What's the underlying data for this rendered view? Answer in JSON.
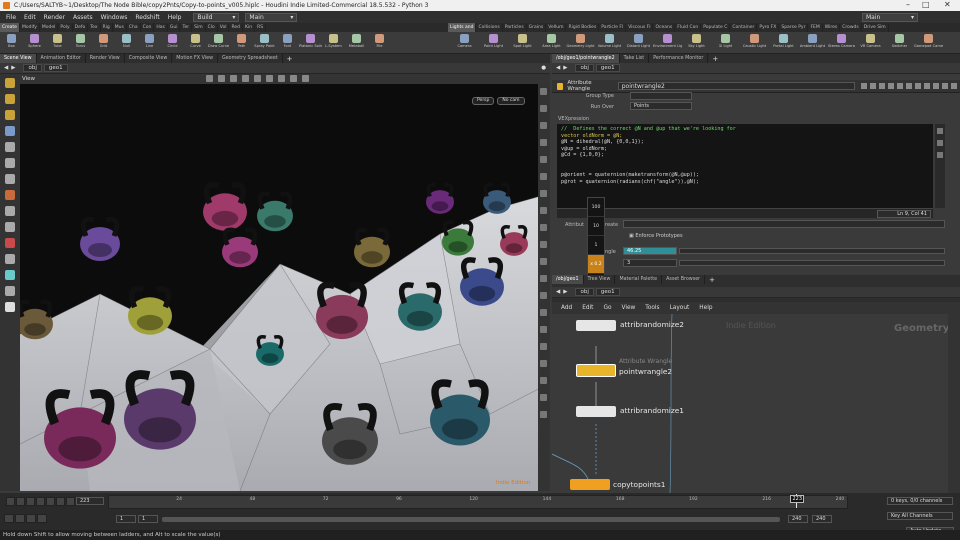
{
  "window": {
    "title": "C:/Users/SALTYB~1/Desktop/The Node Bible/copy2Pnts/Copy-to-points_v005.hiplc - Houdini Indie Limited-Commercial 18.5.532 - Python 3"
  },
  "menu": {
    "items": [
      "File",
      "Edit",
      "Render",
      "Assets",
      "Windows",
      "Redshift",
      "Help"
    ],
    "build_dropdown": "Build",
    "desktop_dropdown": "Main",
    "right_dropdown": "Main"
  },
  "shelf": {
    "left_tabs": [
      "Create",
      "Modify",
      "Model",
      "Poly",
      "Defo",
      "Tex",
      "Rig",
      "Mus",
      "Cha",
      "Con",
      "Has",
      "Gui",
      "Ter",
      "Sim",
      "Clo",
      "Vol",
      "Red",
      "Kin",
      "RS"
    ],
    "left_tools": [
      "Box",
      "Sphere",
      "Tube",
      "Torus",
      "Grid",
      "Null",
      "Line",
      "Circle",
      "Curve",
      "Draw Curve",
      "Path",
      "Spray Paint",
      "Font",
      "Platonic Solids",
      "L-System",
      "Metaball",
      "File"
    ],
    "right_tabs": [
      "Lights and",
      "Collisions",
      "Particles",
      "Grains",
      "Vellum",
      "Rigid Bodies",
      "Particle Fl",
      "Viscous Fl",
      "Oceans",
      "Fluid Con",
      "Populate C",
      "Container",
      "Pyro FX",
      "Sparse Pyr",
      "FEM",
      "Wires",
      "Crowds",
      "Drive Sim"
    ],
    "right_tools": [
      "Camera",
      "Point Light",
      "Spot Light",
      "Area Light",
      "Geometry Light",
      "Volume Light",
      "Distant Light",
      "Environment Light",
      "Sky Light",
      "GI Light",
      "Caustic Light",
      "Portal Light",
      "Ambient Light",
      "Stereo Camera",
      "VR Camera",
      "Switcher",
      "Gamepad Camera"
    ]
  },
  "viewer": {
    "tabs": [
      "Scene View",
      "Animation Editor",
      "Render View",
      "Composite View",
      "Motion FX View",
      "Geometry Spreadsheet"
    ],
    "path": [
      "obj",
      "geo1"
    ],
    "title": "View",
    "persp_btn": "Persp",
    "cam_btn": "No cam",
    "edition_watermark": "Indie Edition"
  },
  "parm": {
    "tabs": [
      "/obj/geo1/pointwrangle2",
      "Take List",
      "Performance Monitor"
    ],
    "path": [
      "obj",
      "geo1"
    ],
    "node_type": "Attribute Wrangle",
    "node_name": "pointwrangle2",
    "group_type_label": "Group Type",
    "run_over_label": "Run Over",
    "run_over_value": "Points",
    "vex_label": "VEXpression",
    "vex_lines": [
      {
        "t": "//  Defines the correct @N and @up that we're looking for",
        "c": "cm"
      },
      {
        "t": "vector oldNorm = @N;",
        "c": "kw"
      },
      {
        "t": "@N = dihedral(@N, {0,0,1});",
        "c": ""
      },
      {
        "t": "v@up = oldNorm;",
        "c": ""
      },
      {
        "t": "@Cd = {1,0,0};",
        "c": ""
      },
      {
        "t": "",
        "c": ""
      },
      {
        "t": "",
        "c": ""
      },
      {
        "t": "p@orient = quaternion(maketransform(@N,@up));",
        "c": ""
      },
      {
        "t": "p@rot = quaternion(radians(chf(\"angle\")),@N);",
        "c": ""
      }
    ],
    "cursor_pos": "Ln 9, Col 41",
    "attrib_label": "Attribut",
    "create_label": "reate",
    "enforce_label": "Enforce Prototypes",
    "angle_label": "ngle",
    "angle_value": "46.25",
    "value_3": "3"
  },
  "ladder": {
    "steps": [
      "100",
      "10",
      "1",
      "x 0.2",
      ".1",
      ".01",
      ".001",
      ".0001"
    ],
    "selected_index": 3,
    "top_value": "100",
    "sel_value": "x 0.2"
  },
  "network": {
    "tabs": [
      "/obj/geo1",
      "Tree View",
      "Material Palette",
      "Asset Browser"
    ],
    "path": [
      "obj",
      "geo1"
    ],
    "menu": [
      "Add",
      "Edit",
      "Go",
      "View",
      "Tools",
      "Layout",
      "Help"
    ],
    "watermark_edition": "Indie Edition",
    "watermark_context": "Geometry",
    "nodes": [
      {
        "name": "attribrandomize2",
        "type": ""
      },
      {
        "name": "pointwrangle2",
        "type": "Attribute Wrangle"
      },
      {
        "name": "attribrandomize1",
        "type": ""
      },
      {
        "name": "copytopoints1",
        "type": ""
      }
    ]
  },
  "timeline": {
    "frame": "223",
    "ticks": [
      "24",
      "48",
      "72",
      "96",
      "120",
      "144",
      "168",
      "192",
      "216",
      "240"
    ],
    "current_marker": "223",
    "range_start": "1",
    "range_start2": "1",
    "range_end": "240",
    "range_end2": "240",
    "keys_info": "0 keys, 0/0 channels",
    "key_all_channels": "Key All Channels",
    "auto_update": "Auto Update",
    "playhead_fraction": 0.929
  },
  "status": {
    "text": "Hold down Shift to allow moving between ladders, and Alt to scale the value(s)"
  },
  "colors": {
    "accent": "#e8a020",
    "node_selected": "#e8b52a",
    "node_copy": "#f0a020",
    "viewport_bg": "#0c0c0c",
    "parm_highlight": "#2f8f96"
  }
}
